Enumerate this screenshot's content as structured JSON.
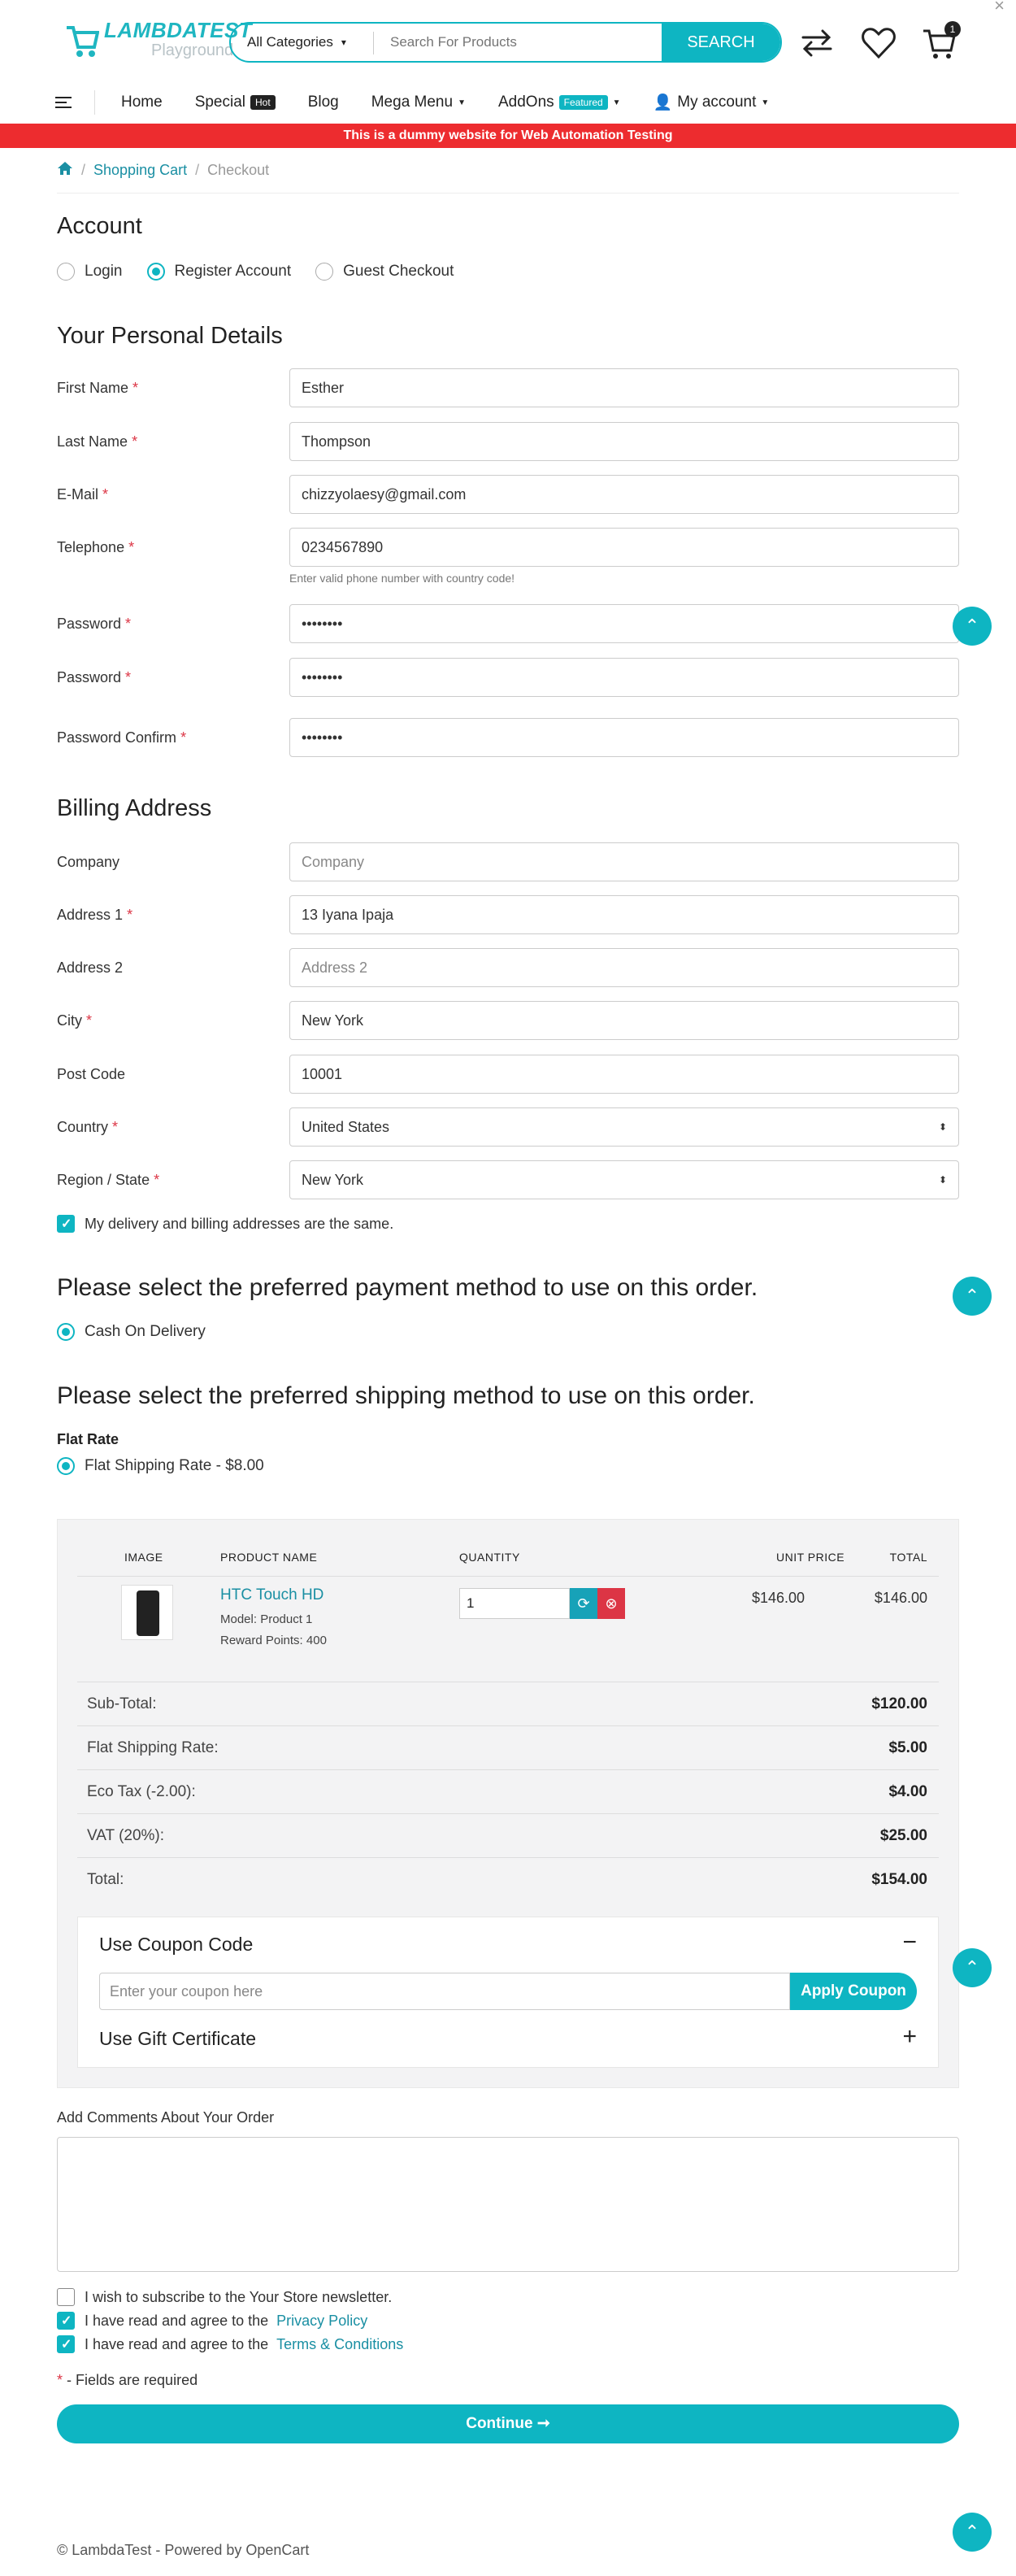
{
  "header": {
    "logo_main": "LAMBDATEST",
    "logo_sub": "Playground",
    "search": {
      "category": "All Categories",
      "placeholder": "Search For Products",
      "button": "SEARCH"
    },
    "cart_count": "1",
    "icons": [
      "compare-icon",
      "wishlist-heart-icon",
      "cart-icon"
    ]
  },
  "nav": {
    "items": [
      "Home",
      "Special",
      "Blog",
      "Mega Menu",
      "AddOns",
      "My account"
    ],
    "special_tag": "Hot",
    "addons_tag": "Featured"
  },
  "banner": "This is a dummy website for Web Automation Testing",
  "breadcrumb": {
    "cart": "Shopping Cart",
    "current": "Checkout"
  },
  "account": {
    "title": "Account",
    "options": [
      "Login",
      "Register Account",
      "Guest Checkout"
    ],
    "selected": "Register Account"
  },
  "personal": {
    "title": "Your Personal Details",
    "fields": {
      "first_name": {
        "label": "First Name",
        "value": "Esther"
      },
      "last_name": {
        "label": "Last Name",
        "value": "Thompson"
      },
      "email": {
        "label": "E-Mail",
        "value": "chizzyolaesy@gmail.com"
      },
      "telephone": {
        "label": "Telephone",
        "value": "0234567890",
        "help": "Enter valid phone number with country code!"
      },
      "password1": {
        "label": "Password",
        "value": "••••••••"
      },
      "password2": {
        "label": "Password",
        "value": "••••••••"
      },
      "confirm": {
        "label": "Password Confirm",
        "value": "••••••••"
      }
    }
  },
  "billing": {
    "title": "Billing Address",
    "fields": {
      "company": {
        "label": "Company",
        "placeholder": "Company"
      },
      "address1": {
        "label": "Address 1",
        "value": "13 Iyana Ipaja"
      },
      "address2": {
        "label": "Address 2",
        "placeholder": "Address 2"
      },
      "city": {
        "label": "City",
        "value": "New York"
      },
      "postcode": {
        "label": "Post Code",
        "value": "10001"
      },
      "country": {
        "label": "Country",
        "value": "United States"
      },
      "region": {
        "label": "Region / State",
        "value": "New York"
      }
    },
    "same_address": "My delivery and billing addresses are the same."
  },
  "payment": {
    "title": "Please select the preferred payment method to use on this order.",
    "option": "Cash On Delivery"
  },
  "shipping": {
    "title": "Please select the preferred shipping method to use on this order.",
    "group": "Flat Rate",
    "option": "Flat Shipping Rate - $8.00"
  },
  "cart": {
    "headers": [
      "IMAGE",
      "PRODUCT NAME",
      "QUANTITY",
      "UNIT PRICE",
      "TOTAL"
    ],
    "product": {
      "name": "HTC Touch HD",
      "model": "Model: Product 1",
      "points": "Reward Points: 400",
      "qty": "1",
      "unit_price": "$146.00",
      "total": "$146.00"
    },
    "totals": [
      {
        "label": "Sub-Total:",
        "value": "$120.00"
      },
      {
        "label": "Flat Shipping Rate:",
        "value": "$5.00"
      },
      {
        "label": "Eco Tax (-2.00):",
        "value": "$4.00"
      },
      {
        "label": "VAT (20%):",
        "value": "$25.00"
      },
      {
        "label": "Total:",
        "value": "$154.00"
      }
    ],
    "coupon": {
      "title": "Use Coupon Code",
      "placeholder": "Enter your coupon here",
      "button": "Apply Coupon",
      "toggle": "−"
    },
    "gift": {
      "title": "Use Gift Certificate",
      "toggle": "+"
    }
  },
  "comments_label": "Add Comments About Your Order",
  "agreements": {
    "newsletter": "I wish to subscribe to the Your Store newsletter.",
    "privacy_prefix": "I have read and agree to the ",
    "privacy_link": "Privacy Policy",
    "terms_prefix": "I have read and agree to the ",
    "terms_link": "Terms & Conditions",
    "required_note": " - Fields are required"
  },
  "continue": "Continue ➞",
  "footer": "© LambdaTest - Powered by OpenCart",
  "colors": {
    "accent": "#0eb5c2",
    "banner": "#ed2c2f",
    "link": "#1a8fa3"
  }
}
